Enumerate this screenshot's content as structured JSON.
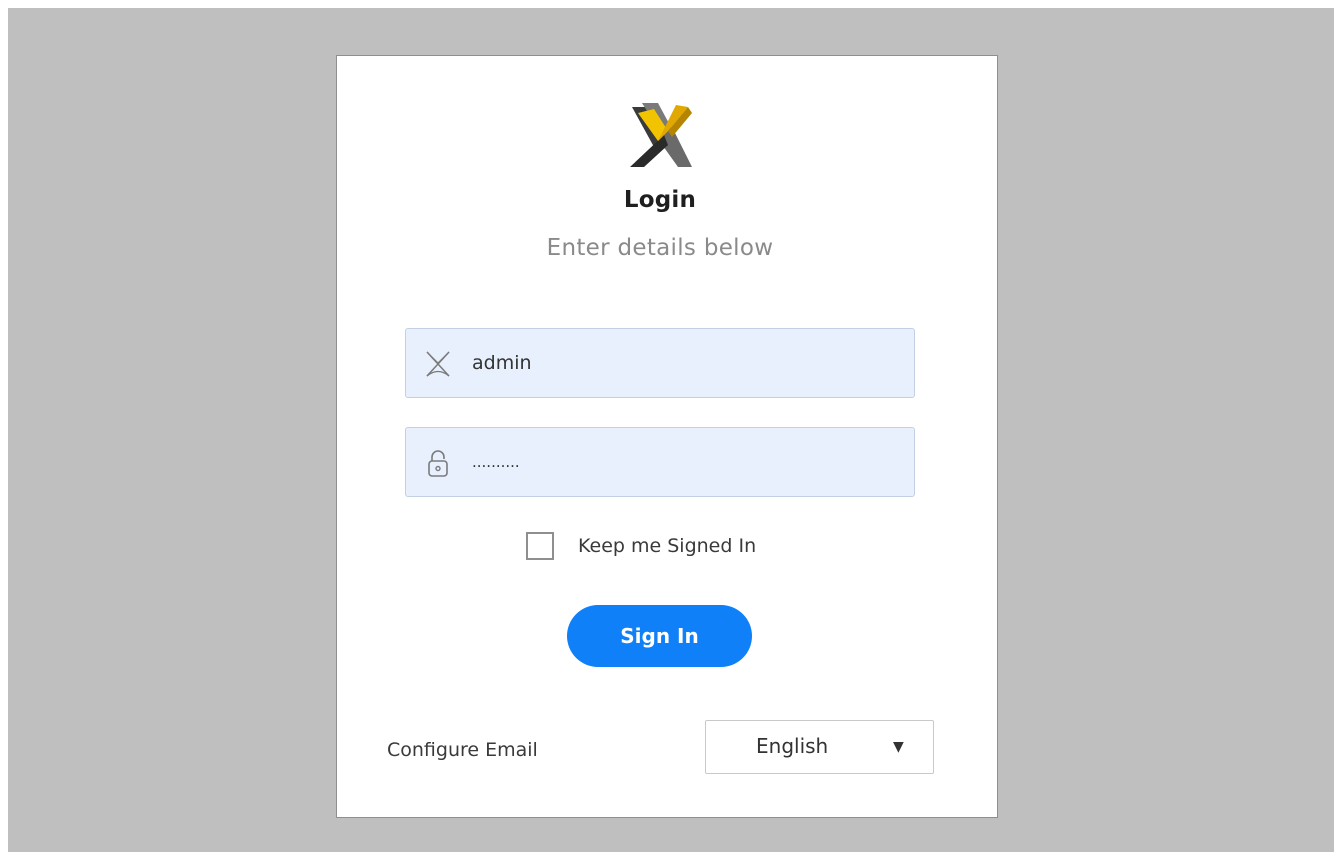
{
  "login": {
    "title": "Login",
    "subtitle": "Enter details below",
    "username": {
      "value": "admin",
      "icon": "user-x-icon"
    },
    "password": {
      "value": "..........",
      "icon": "lock-icon"
    },
    "keep_signed_in": {
      "label": "Keep me Signed In",
      "checked": false
    },
    "sign_in_label": "Sign In",
    "configure_email_label": "Configure Email",
    "language": {
      "selected": "English",
      "icon": "caret-down-icon"
    }
  },
  "colors": {
    "page_background": "#bfbfbf",
    "card_background": "#ffffff",
    "field_background": "#e8f0fe",
    "primary_button": "#0f80f7",
    "logo_gold": "#e8b800",
    "logo_gray": "#5a5a5a"
  }
}
